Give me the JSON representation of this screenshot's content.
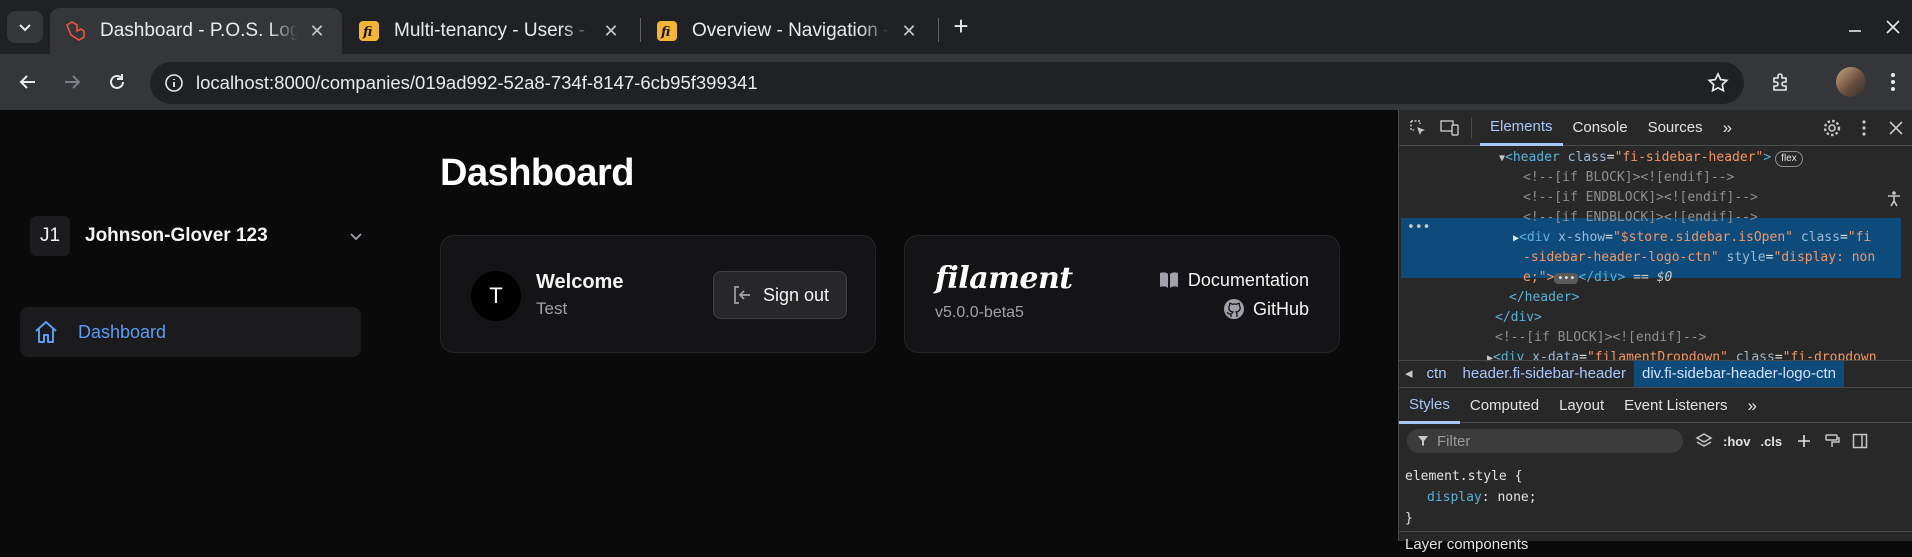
{
  "browser": {
    "tabs": [
      {
        "title": "Dashboard - P.O.S. Log",
        "active": true
      },
      {
        "title": "Multi-tenancy - Users -",
        "active": false
      },
      {
        "title": "Overview - Navigation -",
        "active": false
      }
    ],
    "url": "localhost:8000/companies/019ad992-52a8-734f-8147-6cb95f399341"
  },
  "sidebar": {
    "tenant_initials": "J1",
    "tenant_name": "Johnson-Glover 123",
    "nav": [
      {
        "label": "Dashboard",
        "active": true
      }
    ]
  },
  "main": {
    "title": "Dashboard",
    "welcome_card": {
      "avatar_initial": "T",
      "heading": "Welcome",
      "user": "Test",
      "sign_out": "Sign out"
    },
    "filament_card": {
      "brand": "filament",
      "version": "v5.0.0-beta5",
      "documentation": "Documentation",
      "github": "GitHub"
    }
  },
  "devtools": {
    "tabs": [
      "Elements",
      "Console",
      "Sources"
    ],
    "dom": {
      "l1_tag_open": "<header",
      "l1_attr": "class",
      "l1_val": "\"fi-sidebar-header\"",
      "l1_close": ">",
      "l1_badge": "flex",
      "l2": "<!--[if BLOCK]><![endif]-->",
      "l3": "<!--[if ENDBLOCK]><![endif]-->",
      "l4": "<!--[if ENDBLOCK]><![endif]-->",
      "l5_tag": "<div",
      "l5_a1": "x-show",
      "l5_v1": "\"$store.sidebar.isOpen\"",
      "l5_a2": "class",
      "l5_v2a": "\"fi",
      "l6_v2b": "-sidebar-header-logo-ctn\"",
      "l6_a3": "style",
      "l6_v3a": "\"display: non",
      "l7_v3b": "e;\">",
      "l7_end": "</div>",
      "l7_ref": " == $0",
      "l8": "</header>",
      "l9": "</div>",
      "l10": "<!--[if BLOCK]><![endif]-->",
      "l11_tag": "<div",
      "l11_a1": "x-data",
      "l11_v1": "\"filamentDropdown\"",
      "l11_a2": "class",
      "l11_v2": "\"fi-dropdown"
    },
    "breadcrumbs": [
      "ctn",
      "header.fi-sidebar-header",
      "div.fi-sidebar-header-logo-ctn"
    ],
    "subtabs": [
      "Styles",
      "Computed",
      "Layout",
      "Event Listeners"
    ],
    "filter_placeholder": "Filter",
    "hov": ":hov",
    "cls": ".cls",
    "styles_selector": "element.style {",
    "styles_prop": "display",
    "styles_value": "none;",
    "styles_close": "}",
    "layer": "Layer components"
  },
  "colors": {
    "accent": "#5b9cf3",
    "devtools_active": "#a8c7fa",
    "selection": "#0e4b7a"
  }
}
